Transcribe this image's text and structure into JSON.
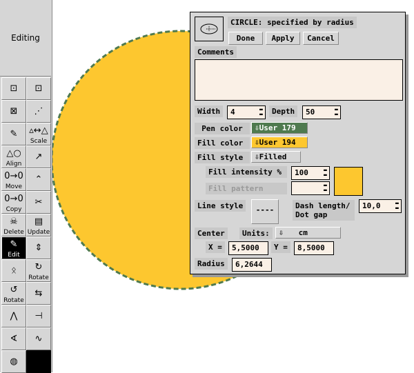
{
  "sidebar": {
    "mode": "Editing",
    "tools": [
      {
        "icon": "select-group-icon",
        "label": ""
      },
      {
        "icon": "ungroup-icon",
        "label": ""
      },
      {
        "icon": "scale-icon",
        "label": ""
      },
      {
        "icon": "point-move-icon",
        "label": ""
      },
      {
        "icon": "broom-icon",
        "label": ""
      },
      {
        "icon": "scale-icon",
        "label": "Scale"
      },
      {
        "icon": "align-icon",
        "label": "Align"
      },
      {
        "icon": "add-point-icon",
        "label": ""
      },
      {
        "icon": "move-icon",
        "label": "Move"
      },
      {
        "icon": "move-point-icon",
        "label": ""
      },
      {
        "icon": "copy-icon",
        "label": "Copy"
      },
      {
        "icon": "cut-icon",
        "label": ""
      },
      {
        "icon": "delete-skull-icon",
        "label": "Delete"
      },
      {
        "icon": "update-icon",
        "label": "Update"
      },
      {
        "icon": "edit-icon",
        "label": "Edit"
      },
      {
        "icon": "flip-icon",
        "label": ""
      },
      {
        "icon": "people-icon",
        "label": ""
      },
      {
        "icon": "rotate-cw-icon",
        "label": "Rotate"
      },
      {
        "icon": "rotate-ccw-icon",
        "label": "Rotate"
      },
      {
        "icon": "convert-icon",
        "label": ""
      },
      {
        "icon": "arrow-mode-icon",
        "label": ""
      },
      {
        "icon": "tangent-icon",
        "label": ""
      },
      {
        "icon": "anglemeas-icon",
        "label": ""
      },
      {
        "icon": "lenmeas-icon",
        "label": ""
      },
      {
        "icon": "areameas-icon",
        "label": ""
      },
      {
        "icon": "",
        "label": ""
      }
    ]
  },
  "canvas": {
    "fill_color": "#fdc72f",
    "pen_color": "#4f7a4f"
  },
  "dialog": {
    "title": "CIRCLE: specified by radius",
    "done": "Done",
    "apply": "Apply",
    "cancel": "Cancel",
    "comments_label": "Comments",
    "comments_value": "",
    "width_label": "Width",
    "width_value": "4",
    "depth_label": "Depth",
    "depth_value": "50",
    "pen_color_label": "Pen color",
    "pen_color_value": "User 179",
    "pen_color_hex": "#4f7a4f",
    "fill_color_label": "Fill color",
    "fill_color_value": "User 194",
    "fill_color_hex": "#fdc72f",
    "fill_style_label": "Fill style",
    "fill_style_value": "Filled",
    "fill_intensity_label": "Fill intensity %",
    "fill_intensity_value": "100",
    "fill_pattern_label": "Fill pattern",
    "fill_pattern_value": "",
    "line_style_label": "Line style",
    "line_style_value": "----",
    "dash_label_1": "Dash length/",
    "dash_label_2": "Dot gap",
    "dash_value": "10,0",
    "center_label": "Center",
    "units_label": "Units:",
    "units_value": "cm",
    "x_label": "X =",
    "x_value": "5,5000",
    "y_label": "Y =",
    "y_value": "8,5000",
    "radius_label": "Radius",
    "radius_value": "6,2644"
  }
}
